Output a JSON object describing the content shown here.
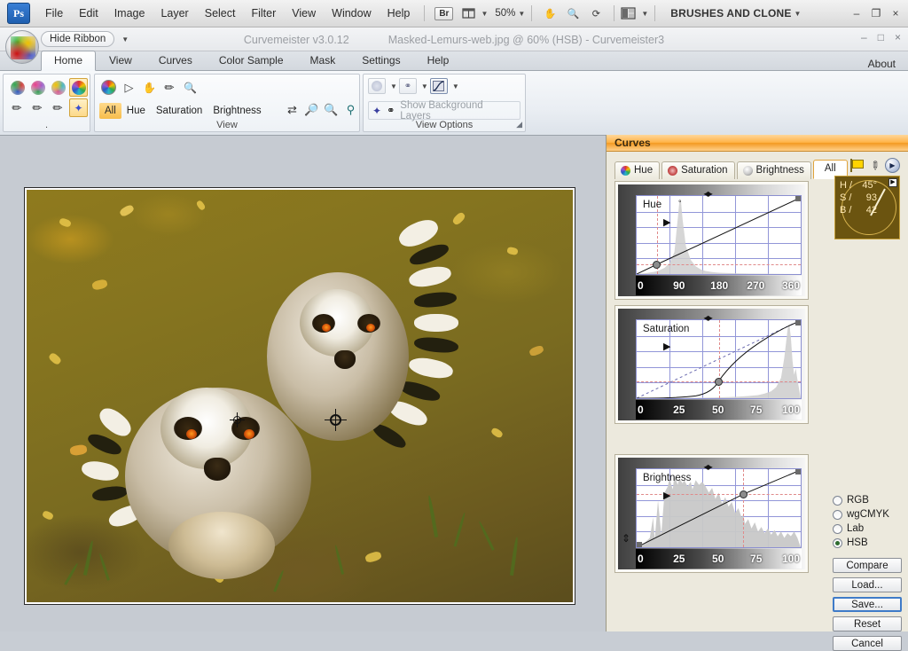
{
  "ps_menubar": {
    "logo": "Ps",
    "menus": [
      "File",
      "Edit",
      "Image",
      "Layer",
      "Select",
      "Filter",
      "View",
      "Window",
      "Help"
    ],
    "bridge_label": "Br",
    "zoom_value": "50%",
    "workspace_label": "BRUSHES AND CLONE",
    "window_buttons": [
      "–",
      "❐",
      "×"
    ]
  },
  "cm_titlebar": {
    "hide_ribbon_label": "Hide Ribbon",
    "app_title": "Curvemeister v3.0.12",
    "document_title": "Masked-Lemurs-web.jpg @ 60% (HSB) -  Curvemeister3",
    "window_buttons": [
      "–",
      "□",
      "×"
    ]
  },
  "ribbon": {
    "tabs": [
      "Home",
      "View",
      "Curves",
      "Color Sample",
      "Mask",
      "Settings",
      "Help"
    ],
    "active_tab": "Home",
    "about_label": "About",
    "groups": {
      "colors": {
        "label": ".",
        "top_icons": [
          "color-sphere-1",
          "color-sphere-2",
          "color-sphere-3",
          "color-sphere-4"
        ],
        "bottom_icons": [
          "eyedropper-1",
          "eyedropper-2",
          "eyedropper-3",
          "magic-wand"
        ]
      },
      "view": {
        "label": "View",
        "top_icons": [
          "curvemeister-orb",
          "arrow-select",
          "hand",
          "eyedropper",
          "zoom"
        ],
        "channels": [
          "All",
          "Hue",
          "Saturation",
          "Brightness"
        ],
        "active_channel": "All",
        "zoom_buttons": [
          "zoom-in",
          "zoom-out",
          "zoom-fit",
          "zoom-actual"
        ]
      },
      "view_options": {
        "label": "View Options",
        "show_background_layers": "Show Background Layers"
      }
    }
  },
  "curves_panel": {
    "title": "Curves",
    "tabs": [
      {
        "label": "Hue",
        "dot": "hue"
      },
      {
        "label": "Saturation",
        "dot": "sat"
      },
      {
        "label": "Brightness",
        "dot": "bri"
      },
      {
        "label": "All",
        "dot": "none"
      }
    ],
    "active_tab": "All",
    "tool_icons": [
      "flag-icon",
      "wrench-icon",
      "play-icon"
    ],
    "color_readout": {
      "rows": [
        {
          "key": "H /",
          "value": "45°"
        },
        {
          "key": "S /",
          "value": "93"
        },
        {
          "key": "B /",
          "value": "42"
        }
      ],
      "corner_icon": "▶",
      "background": "#6b5410"
    },
    "color_modes": [
      {
        "label": "RGB",
        "selected": false
      },
      {
        "label": "wgCMYK",
        "selected": false
      },
      {
        "label": "Lab",
        "selected": false
      },
      {
        "label": "HSB",
        "selected": true
      }
    ],
    "buttons": [
      {
        "label": "Compare",
        "focused": false
      },
      {
        "label": "Load...",
        "focused": false
      },
      {
        "label": "Save...",
        "focused": true
      },
      {
        "label": "Reset",
        "focused": false
      },
      {
        "label": "Cancel",
        "focused": false
      }
    ]
  },
  "chart_data": [
    {
      "type": "line",
      "title": "Hue",
      "unit": "°",
      "xlabel": "",
      "ylabel": "",
      "xlim": [
        0,
        360
      ],
      "ylim": [
        0,
        360
      ],
      "ticks": [
        "0",
        "90",
        "180",
        "270",
        "360"
      ],
      "grid": true,
      "curve_points": [
        [
          0,
          0
        ],
        [
          45,
          45
        ],
        [
          360,
          360
        ]
      ],
      "control_points": [
        [
          45,
          45
        ]
      ],
      "reference_lines": {
        "vertical": 45,
        "horizontal": 45
      },
      "histogram_peak": 45,
      "histogram": [
        1,
        1,
        2,
        2,
        3,
        4,
        6,
        10,
        22,
        68,
        96,
        52,
        18,
        9,
        6,
        4,
        3,
        2,
        2,
        1,
        1,
        1,
        1,
        1,
        1,
        1,
        1,
        1,
        1,
        1,
        1,
        1,
        1,
        1,
        1,
        1
      ]
    },
    {
      "type": "line",
      "title": "Saturation",
      "unit": "",
      "xlabel": "",
      "ylabel": "",
      "xlim": [
        0,
        100
      ],
      "ylim": [
        0,
        100
      ],
      "ticks": [
        "0",
        "25",
        "50",
        "75",
        "100"
      ],
      "grid": true,
      "curve_points": [
        [
          0,
          0
        ],
        [
          12,
          0.5
        ],
        [
          25,
          1
        ],
        [
          35,
          2
        ],
        [
          45,
          10
        ],
        [
          50,
          22
        ],
        [
          60,
          35
        ],
        [
          70,
          50
        ],
        [
          80,
          66
        ],
        [
          90,
          82
        ],
        [
          100,
          100
        ]
      ],
      "control_points": [
        [
          50,
          22
        ]
      ],
      "baseline_dashed": [
        [
          0,
          0
        ],
        [
          100,
          100
        ]
      ],
      "reference_lines": {
        "vertical": 50,
        "horizontal": 22
      },
      "histogram_peak": 97,
      "histogram": [
        1,
        1,
        1,
        1,
        1,
        1,
        1,
        1,
        1,
        1,
        1,
        1,
        1,
        1,
        2,
        2,
        3,
        3,
        4,
        5,
        6,
        8,
        12,
        22,
        48,
        92,
        70,
        30,
        12,
        6
      ]
    },
    {
      "type": "line",
      "title": "Brightness",
      "unit": "",
      "xlabel": "",
      "ylabel": "",
      "xlim": [
        0,
        100
      ],
      "ylim": [
        0,
        100
      ],
      "ticks": [
        "0",
        "25",
        "50",
        "75",
        "100"
      ],
      "grid": true,
      "curve_points": [
        [
          0,
          0
        ],
        [
          65,
          68
        ],
        [
          100,
          100
        ]
      ],
      "control_points": [
        [
          65,
          68
        ]
      ],
      "reference_lines": {
        "vertical": 65,
        "horizontal": 68
      },
      "histogram": [
        3,
        4,
        6,
        10,
        14,
        12,
        30,
        16,
        45,
        70,
        88,
        72,
        96,
        78,
        90,
        84,
        92,
        80,
        86,
        74,
        90,
        76,
        68,
        58,
        70,
        40,
        52,
        26,
        18,
        14,
        20,
        16,
        24,
        18,
        22,
        20,
        26,
        22,
        28,
        24,
        30,
        26,
        22,
        20,
        24,
        18,
        16,
        14,
        12,
        10
      ]
    }
  ],
  "canvas": {
    "crosshair_cursors": [
      "sample-point-small",
      "sample-point-large"
    ]
  }
}
